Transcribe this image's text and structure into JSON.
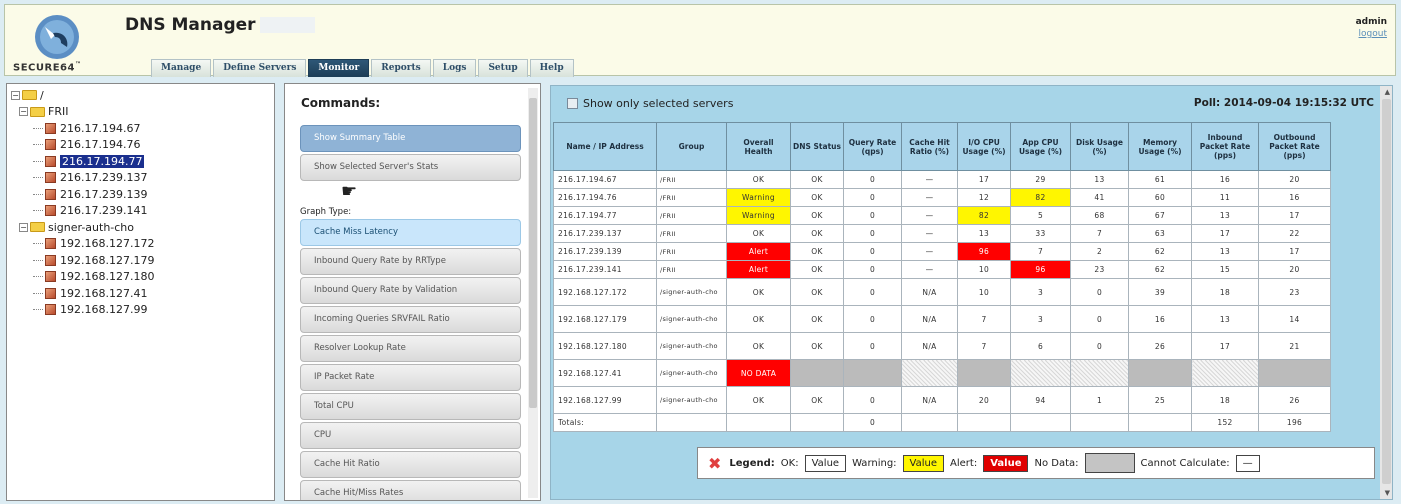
{
  "header": {
    "title": "DNS Manager",
    "logo_text": "SECURE64",
    "logo_mark": "™",
    "user": "admin",
    "logout": "logout"
  },
  "tabs": [
    "Manage",
    "Define Servers",
    "Monitor",
    "Reports",
    "Logs",
    "Setup",
    "Help"
  ],
  "active_tab": "Monitor",
  "tree": {
    "root": "/",
    "groups": [
      {
        "name": "FRII",
        "servers": [
          "216.17.194.67",
          "216.17.194.76",
          "216.17.194.77",
          "216.17.239.137",
          "216.17.239.139",
          "216.17.239.141"
        ]
      },
      {
        "name": "signer-auth-cho",
        "servers": [
          "192.168.127.172",
          "192.168.127.179",
          "192.168.127.180",
          "192.168.127.41",
          "192.168.127.99"
        ]
      }
    ],
    "selected": "216.17.194.77"
  },
  "commands": {
    "title": "Commands:",
    "show_summary": "Show Summary Table",
    "show_selected": "Show Selected Server's Stats",
    "graph_type": "Graph Type:",
    "graphs": [
      "Cache Miss Latency",
      "Inbound Query Rate by RRType",
      "Inbound Query Rate by Validation",
      "Incoming Queries SRVFAIL Ratio",
      "Resolver Lookup Rate",
      "IP Packet Rate",
      "Total CPU",
      "CPU",
      "Cache Hit Ratio",
      "Cache Hit/Miss Rates"
    ],
    "active_graph": "Cache Miss Latency"
  },
  "monitor": {
    "show_only": "Show only selected servers",
    "poll": "Poll: 2014-09-04 19:15:32 UTC",
    "columns": [
      "Name / IP Address",
      "Group",
      "Overall Health",
      "DNS Status",
      "Query Rate (qps)",
      "Cache Hit Ratio (%)",
      "I/O CPU Usage (%)",
      "App CPU Usage (%)",
      "Disk Usage (%)",
      "Memory Usage (%)",
      "Inbound Packet Rate (pps)",
      "Outbound Packet Rate (pps)"
    ],
    "rows": [
      [
        "216.17.194.67",
        "/FRII",
        "OK",
        "OK",
        "0",
        "—",
        "17",
        "29",
        "13",
        "61",
        "16",
        "20"
      ],
      [
        "216.17.194.76",
        "/FRII",
        "Warning",
        "OK",
        "0",
        "—",
        "12",
        "82",
        "41",
        "60",
        "11",
        "16"
      ],
      [
        "216.17.194.77",
        "/FRII",
        "Warning",
        "OK",
        "0",
        "—",
        "82",
        "5",
        "68",
        "67",
        "13",
        "17"
      ],
      [
        "216.17.239.137",
        "/FRII",
        "OK",
        "OK",
        "0",
        "—",
        "13",
        "33",
        "7",
        "63",
        "17",
        "22"
      ],
      [
        "216.17.239.139",
        "/FRII",
        "Alert",
        "OK",
        "0",
        "—",
        "96",
        "7",
        "2",
        "62",
        "13",
        "17"
      ],
      [
        "216.17.239.141",
        "/FRII",
        "Alert",
        "OK",
        "0",
        "—",
        "10",
        "96",
        "23",
        "62",
        "15",
        "20"
      ],
      [
        "192.168.127.172",
        "/signer-auth-cho",
        "OK",
        "OK",
        "0",
        "N/A",
        "10",
        "3",
        "0",
        "39",
        "18",
        "23"
      ],
      [
        "192.168.127.179",
        "/signer-auth-cho",
        "OK",
        "OK",
        "0",
        "N/A",
        "7",
        "3",
        "0",
        "16",
        "13",
        "14"
      ],
      [
        "192.168.127.180",
        "/signer-auth-cho",
        "OK",
        "OK",
        "0",
        "N/A",
        "7",
        "6",
        "0",
        "26",
        "17",
        "21"
      ],
      [
        "192.168.127.41",
        "/signer-auth-cho",
        "NO DATA",
        "",
        "",
        "",
        "",
        "",
        "",
        "",
        "",
        ""
      ],
      [
        "192.168.127.99",
        "/signer-auth-cho",
        "OK",
        "OK",
        "0",
        "N/A",
        "20",
        "94",
        "1",
        "25",
        "18",
        "26"
      ]
    ],
    "totals": [
      "Totals:",
      "",
      "",
      "",
      "0",
      "",
      "",
      "",
      "",
      "",
      "152",
      "196"
    ],
    "highlights": {
      "yellow": [
        [
          1,
          2
        ],
        [
          1,
          7
        ],
        [
          2,
          2
        ],
        [
          2,
          6
        ]
      ],
      "red": [
        [
          4,
          2
        ],
        [
          4,
          6
        ],
        [
          5,
          2
        ],
        [
          5,
          7
        ],
        [
          9,
          2
        ]
      ]
    },
    "legend": {
      "title": "Legend:",
      "ok": "OK:",
      "ok_val": "Value",
      "warning": "Warning:",
      "warning_val": "Value",
      "alert": "Alert:",
      "alert_val": "Value",
      "nodata": "No Data:",
      "cannot": "Cannot Calculate:",
      "cannot_val": "—"
    }
  },
  "colors": {
    "warning": "#fff600",
    "alert": "#ff0000",
    "header_bg": "#a9d4ea",
    "active_tab": "#2e5777"
  }
}
